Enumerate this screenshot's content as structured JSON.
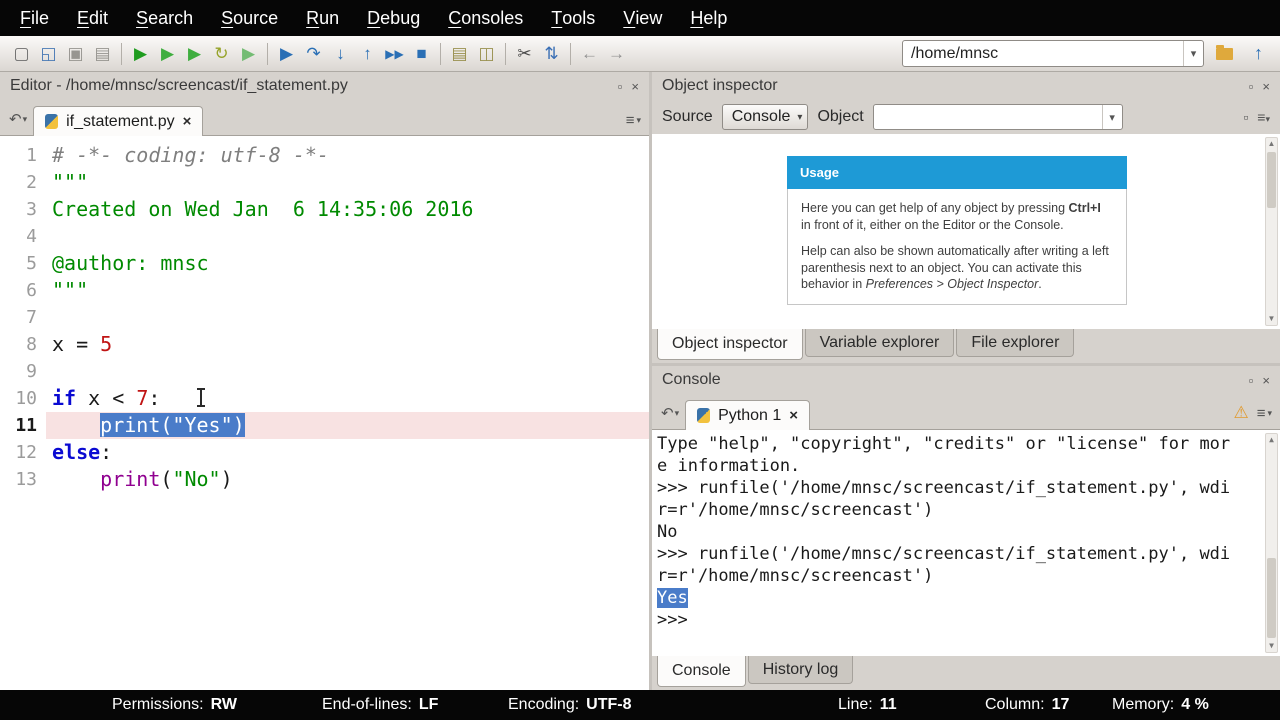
{
  "icons": {
    "close": "×",
    "dropdown": "▾",
    "options": "≡",
    "browse_tabs": "↶",
    "undock": "▫",
    "warning": "⚠",
    "scroll_up": "▲",
    "scroll_down": "▼"
  },
  "menu": {
    "items": [
      "File",
      "Edit",
      "Search",
      "Source",
      "Run",
      "Debug",
      "Consoles",
      "Tools",
      "View",
      "Help"
    ]
  },
  "toolbar": {
    "path_value": "/home/mnsc",
    "buttons": [
      {
        "name": "new-file",
        "glyph": "▢",
        "color": "#6e6e6e"
      },
      {
        "name": "open-file",
        "glyph": "◱",
        "color": "#4a7ab5"
      },
      {
        "name": "save-file",
        "glyph": "▣",
        "color": "#979590"
      },
      {
        "name": "save-all",
        "glyph": "▤",
        "color": "#979590"
      },
      {
        "sep": true
      },
      {
        "name": "run-file",
        "glyph": "▶",
        "color": "#1f9c1f"
      },
      {
        "name": "run-cell",
        "glyph": "▶",
        "color": "#3fae3f"
      },
      {
        "name": "run-cell-advance",
        "glyph": "▶",
        "color": "#3fae3f"
      },
      {
        "name": "rerun-file",
        "glyph": "↻",
        "color": "#96a32a"
      },
      {
        "name": "run-selection",
        "glyph": "▶",
        "color": "#74bc74"
      },
      {
        "sep": true
      },
      {
        "name": "debug-file",
        "glyph": "▶",
        "color": "#2a6fb5"
      },
      {
        "name": "step-over",
        "glyph": "↷",
        "color": "#2a6fb5"
      },
      {
        "name": "step-into",
        "glyph": "↓",
        "color": "#2a6fb5"
      },
      {
        "name": "step-return",
        "glyph": "↑",
        "color": "#2a6fb5"
      },
      {
        "name": "debug-continue",
        "glyph": "▶▶",
        "color": "#2a6fb5"
      },
      {
        "name": "debug-stop",
        "glyph": "■",
        "color": "#2a6fb5"
      },
      {
        "sep": true
      },
      {
        "name": "maximize-pane",
        "glyph": "▤",
        "color": "#9a9150"
      },
      {
        "name": "split-layout",
        "glyph": "◫",
        "color": "#9a9150"
      },
      {
        "sep": true
      },
      {
        "name": "tools",
        "glyph": "✂",
        "color": "#4a4a4a"
      },
      {
        "name": "python-path-manager",
        "glyph": "⇅",
        "color": "#3a6fb5"
      },
      {
        "sep": true
      },
      {
        "name": "back",
        "glyph": "←",
        "color": "#8f8f8f"
      },
      {
        "name": "forward",
        "glyph": "→",
        "color": "#8f8f8f"
      }
    ]
  },
  "editor": {
    "pane_title": "Editor - /home/mnsc/screencast/if_statement.py",
    "tab_label": "if_statement.py",
    "code_lines": [
      {
        "n": "1",
        "parts": [
          [
            "comment",
            "# -*- coding: utf-8 -*-"
          ]
        ]
      },
      {
        "n": "2",
        "parts": [
          [
            "string",
            "\"\"\""
          ]
        ]
      },
      {
        "n": "3",
        "parts": [
          [
            "string",
            "Created on Wed Jan  6 14:35:06 2016"
          ]
        ]
      },
      {
        "n": "4",
        "parts": []
      },
      {
        "n": "5",
        "parts": [
          [
            "string",
            "@author: mnsc"
          ]
        ]
      },
      {
        "n": "6",
        "parts": [
          [
            "string",
            "\"\"\""
          ]
        ]
      },
      {
        "n": "7",
        "parts": []
      },
      {
        "n": "8",
        "parts": [
          [
            "plain",
            "x = "
          ],
          [
            "number",
            "5"
          ]
        ]
      },
      {
        "n": "9",
        "parts": []
      },
      {
        "n": "10",
        "parts": [
          [
            "keyword",
            "if"
          ],
          [
            "plain",
            " x < "
          ],
          [
            "number",
            "7"
          ],
          [
            "plain",
            ":"
          ]
        ]
      },
      {
        "n": "11",
        "current": true,
        "parts": [
          [
            "plain",
            "    "
          ],
          [
            "selected",
            "print(\"Yes\")"
          ]
        ]
      },
      {
        "n": "12",
        "parts": [
          [
            "keyword",
            "else"
          ],
          [
            "plain",
            ":"
          ]
        ]
      },
      {
        "n": "13",
        "parts": [
          [
            "plain",
            "    "
          ],
          [
            "builtin",
            "print"
          ],
          [
            "plain",
            "("
          ],
          [
            "string",
            "\"No\""
          ],
          [
            "plain",
            ")"
          ]
        ]
      }
    ]
  },
  "object_inspector": {
    "pane_title": "Object inspector",
    "source_label": "Source",
    "source_value": "Console",
    "object_label": "Object",
    "object_value": "",
    "usage": {
      "title": "Usage",
      "p1_pre": "Here you can get help of any object by pressing ",
      "p1_bold": "Ctrl+I",
      "p1_post": " in front of it, either on the Editor or the Console.",
      "p2_pre": "Help can also be shown automatically after writing a left parenthesis next to an object. You can activate this behavior in ",
      "p2_italic": "Preferences > Object Inspector",
      "p2_post": "."
    },
    "tabs": [
      "Object inspector",
      "Variable explorer",
      "File explorer"
    ],
    "active_tab": 0
  },
  "console": {
    "pane_title": "Console",
    "tab_label": "Python 1",
    "lines": [
      {
        "text": "Type \"help\", \"copyright\", \"credits\" or \"license\" for mor"
      },
      {
        "text": "e information."
      },
      {
        "text": ">>> runfile('/home/mnsc/screencast/if_statement.py', wdi"
      },
      {
        "text": "r=r'/home/mnsc/screencast')"
      },
      {
        "text": "No"
      },
      {
        "text": ">>> runfile('/home/mnsc/screencast/if_statement.py', wdi"
      },
      {
        "text": "r=r'/home/mnsc/screencast')"
      },
      {
        "text": "Yes",
        "selected": true
      },
      {
        "text": ">>>"
      }
    ],
    "tabs": [
      "Console",
      "History log"
    ],
    "active_tab": 0
  },
  "status_bar": {
    "items": [
      {
        "key": "permissions",
        "label": "Permissions:",
        "value": "RW"
      },
      {
        "key": "end-of-lines",
        "label": "End-of-lines:",
        "value": "LF"
      },
      {
        "key": "encoding",
        "label": "Encoding:",
        "value": "UTF-8"
      },
      {
        "key": "line",
        "label": "Line:",
        "value": "11"
      },
      {
        "key": "column",
        "label": "Column:",
        "value": "17"
      },
      {
        "key": "memory",
        "label": "Memory:",
        "value": "4 %"
      }
    ]
  },
  "colors": {
    "selection": "#4a7cc9",
    "current_line": "#f8e2e2",
    "usage_header": "#1e9ad6",
    "keyword": "#0a0ad2",
    "string": "#008a00",
    "number": "#c01414",
    "builtin": "#900090",
    "comment": "#7f7f7f"
  }
}
